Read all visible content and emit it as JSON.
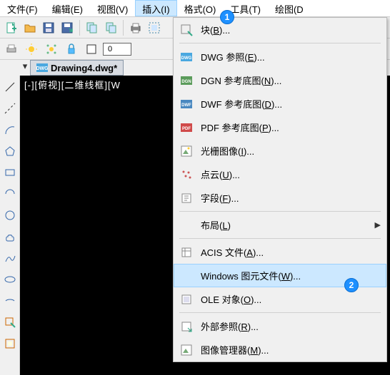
{
  "menubar": [
    {
      "label": "文件(F)",
      "active": false
    },
    {
      "label": "编辑(E)",
      "active": false
    },
    {
      "label": "视图(V)",
      "active": false
    },
    {
      "label": "插入(I)",
      "active": true
    },
    {
      "label": "格式(O)",
      "active": false
    },
    {
      "label": "工具(T)",
      "active": false
    },
    {
      "label": "绘图(D",
      "active": false
    }
  ],
  "tab": {
    "filename": "Drawing4.dwg*"
  },
  "viewport": {
    "label": "[-][俯视][二维线框][W"
  },
  "linewidth": "0",
  "dropdown": [
    {
      "icon": "block",
      "pre": "块(",
      "u": "B",
      "post": ")...",
      "type": "item"
    },
    {
      "type": "sep"
    },
    {
      "icon": "dwg",
      "pre": "DWG 参照(",
      "u": "E",
      "post": ")...",
      "type": "item"
    },
    {
      "icon": "dgn",
      "pre": "DGN 参考底图(",
      "u": "N",
      "post": ")...",
      "type": "item"
    },
    {
      "icon": "dwf",
      "pre": "DWF 参考底图(",
      "u": "D",
      "post": ")...",
      "type": "item"
    },
    {
      "icon": "pdf",
      "pre": "PDF 参考底图(",
      "u": "P",
      "post": ")...",
      "type": "item"
    },
    {
      "icon": "raster",
      "pre": "光栅图像(",
      "u": "I",
      "post": ")...",
      "type": "item"
    },
    {
      "icon": "pointcloud",
      "pre": "点云(",
      "u": "U",
      "post": ")...",
      "type": "item"
    },
    {
      "icon": "field",
      "pre": "字段(",
      "u": "F",
      "post": ")...",
      "type": "item"
    },
    {
      "type": "sep"
    },
    {
      "icon": "",
      "pre": "布局(",
      "u": "L",
      "post": ")",
      "type": "submenu"
    },
    {
      "type": "sep"
    },
    {
      "icon": "acis",
      "pre": "ACIS 文件(",
      "u": "A",
      "post": ")...",
      "type": "item"
    },
    {
      "icon": "",
      "pre": "Windows 图元文件(",
      "u": "W",
      "post": ")...",
      "type": "item",
      "hover": true
    },
    {
      "icon": "ole",
      "pre": "OLE 对象(",
      "u": "O",
      "post": ")...",
      "type": "item"
    },
    {
      "type": "sep"
    },
    {
      "icon": "xref",
      "pre": "外部参照(",
      "u": "R",
      "post": ")...",
      "type": "item"
    },
    {
      "icon": "imgmgr",
      "pre": "图像管理器(",
      "u": "M",
      "post": ")...",
      "type": "item"
    }
  ],
  "badges": {
    "b1": "1",
    "b2": "2"
  }
}
